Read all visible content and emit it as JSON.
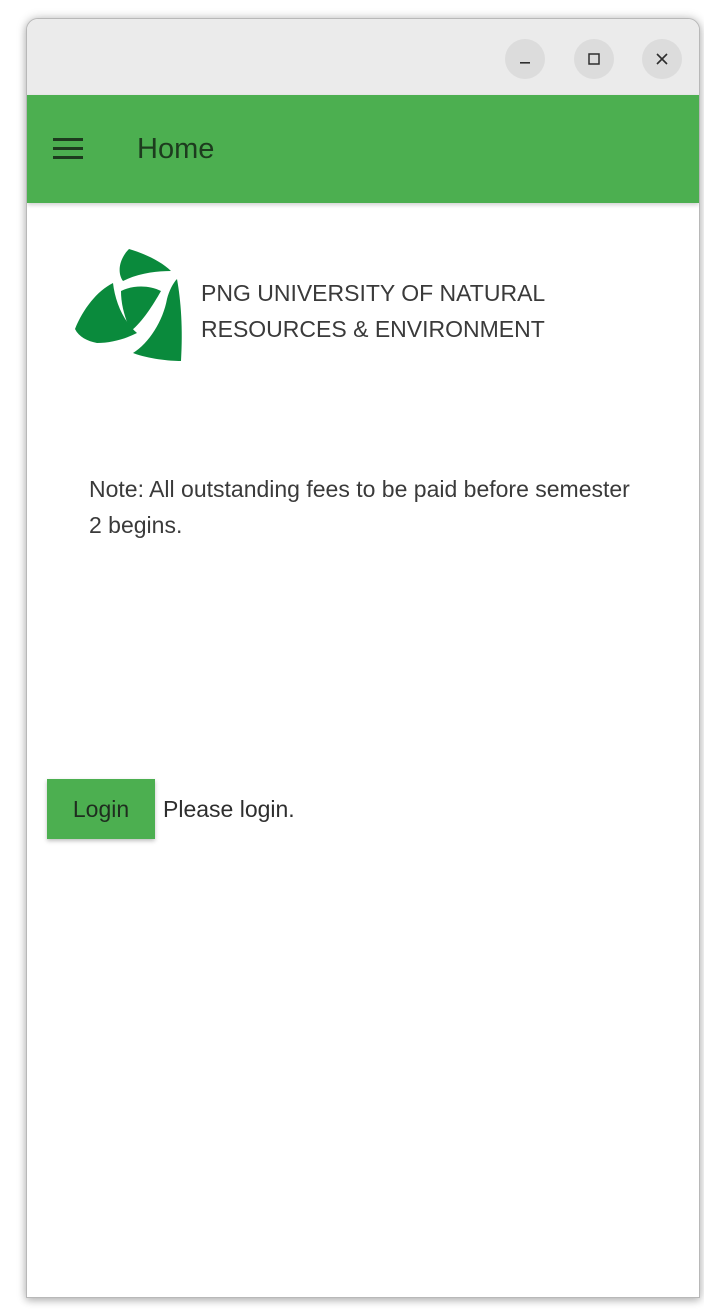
{
  "window": {
    "controls": {
      "minimize_icon": "minimize-icon",
      "maximize_icon": "maximize-icon",
      "close_icon": "close-icon"
    }
  },
  "appbar": {
    "menu_icon": "hamburger-menu-icon",
    "title": "Home",
    "color": "#4caf50"
  },
  "header": {
    "logo_icon": "university-logo",
    "institution_name": "PNG UNIVERSITY OF NATURAL\nRESOURCES & ENVIRONMENT",
    "logo_color": "#0a8a3c"
  },
  "notice": {
    "text": "Note: All outstanding fees to be paid before semester 2 begins."
  },
  "login": {
    "button_label": "Login",
    "message": "Please login."
  }
}
